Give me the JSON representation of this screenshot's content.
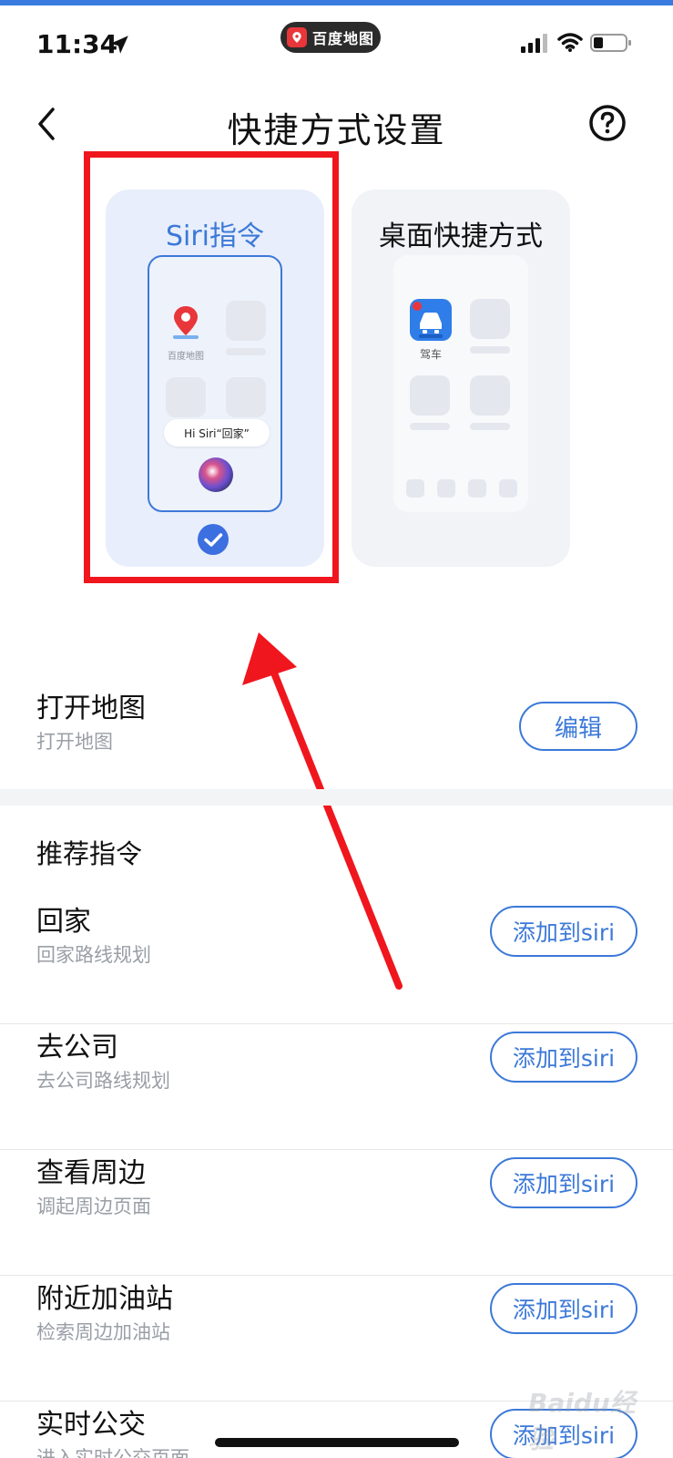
{
  "status_bar": {
    "time": "11:34",
    "app_name": "百度地图"
  },
  "nav": {
    "title": "快捷方式设置"
  },
  "shortcut_types": [
    {
      "title": "Siri指令",
      "selected": true,
      "mock_app_label": "百度地图",
      "siri_phrase": "Hi Siri“回家”"
    },
    {
      "title": "桌面快捷方式",
      "selected": false,
      "mock_app_label": "驾车"
    }
  ],
  "open_map": {
    "title": "打开地图",
    "subtitle": "打开地图",
    "button": "编辑"
  },
  "recommended": {
    "section_title": "推荐指令",
    "items": [
      {
        "title": "回家",
        "subtitle": "回家路线规划",
        "button": "添加到siri"
      },
      {
        "title": "去公司",
        "subtitle": "去公司路线规划",
        "button": "添加到siri"
      },
      {
        "title": "查看周边",
        "subtitle": "调起周边页面",
        "button": "添加到siri"
      },
      {
        "title": "附近加油站",
        "subtitle": "检索周边加油站",
        "button": "添加到siri"
      },
      {
        "title": "实时公交",
        "subtitle": "进入实时公交页面",
        "button": "添加到siri"
      }
    ]
  },
  "watermark": "Baidu经验",
  "colors": {
    "accent": "#3c79d8",
    "annotation_red": "#f0161e",
    "top_strip": "#3a7be0"
  },
  "icons": {
    "back": "back-chevron-icon",
    "help": "help-circle-icon",
    "check": "check-circle-icon"
  }
}
